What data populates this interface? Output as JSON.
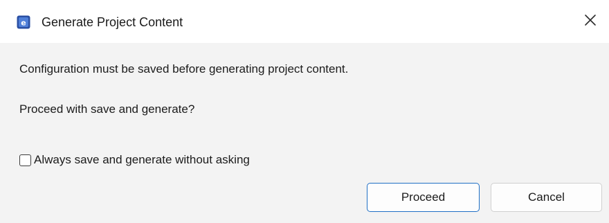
{
  "dialog": {
    "title": "Generate Project Content",
    "icon": "app-icon",
    "close_icon": "close-icon",
    "message_line1": "Configuration must be saved before generating project content.",
    "message_line2": "Proceed with save and generate?",
    "checkbox": {
      "label": "Always save and generate without asking",
      "checked": false
    },
    "buttons": {
      "proceed_label": "Proceed",
      "cancel_label": "Cancel"
    }
  },
  "colors": {
    "titlebar_bg": "#ffffff",
    "body_bg": "#f3f3f3",
    "default_button_border": "#1f6fc5",
    "icon_blue": "#2a4fa3"
  }
}
